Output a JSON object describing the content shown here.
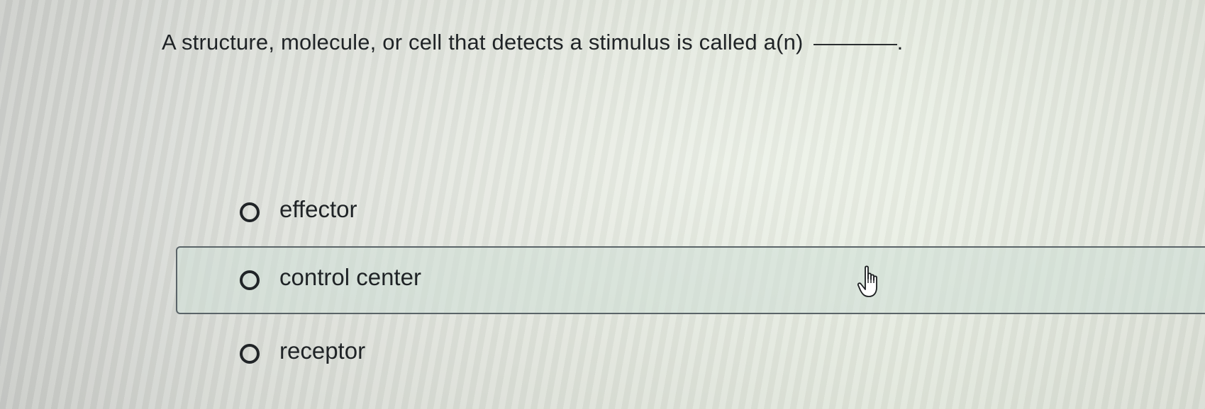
{
  "question": {
    "text": "A structure, molecule, or cell that detects a stimulus is called a(n)",
    "trailing": "."
  },
  "options": [
    {
      "label": "effector",
      "selected": false
    },
    {
      "label": "control center",
      "selected": false,
      "hovered": true
    },
    {
      "label": "receptor",
      "selected": false
    }
  ],
  "cursor": {
    "icon": "hand-pointer-icon"
  },
  "colors": {
    "text": "#1f2326",
    "hover_background": "#cddED6",
    "hover_border": "#5a6468"
  }
}
